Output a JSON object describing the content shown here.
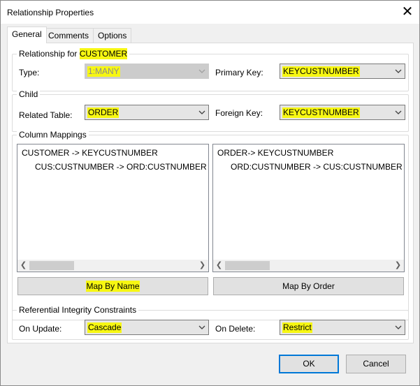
{
  "window": {
    "title": "Relationship Properties",
    "close_glyph": "✕"
  },
  "tabs": [
    {
      "label": "General",
      "active": true
    },
    {
      "label": "Comments",
      "active": false
    },
    {
      "label": "Options",
      "active": false
    }
  ],
  "relationship": {
    "group_prefix": "Relationship for ",
    "group_table": "CUSTOMER",
    "type_label": "Type:",
    "type_value": "1:MANY",
    "primary_key_label": "Primary Key:",
    "primary_key_value": "KEYCUSTNUMBER"
  },
  "child": {
    "group_label": "Child",
    "related_table_label": "Related Table:",
    "related_table_value": "ORDER",
    "foreign_key_label": "Foreign Key:",
    "foreign_key_value": "KEYCUSTNUMBER"
  },
  "mappings": {
    "group_label": "Column Mappings",
    "left_list": [
      "CUSTOMER -> KEYCUSTNUMBER",
      "CUS:CUSTNUMBER -> ORD:CUSTNUMBER"
    ],
    "right_list": [
      "ORDER-> KEYCUSTNUMBER",
      "ORD:CUSTNUMBER -> CUS:CUSTNUMBER"
    ],
    "map_by_name": "Map By Name",
    "map_by_order": "Map By Order"
  },
  "integrity": {
    "group_label": "Referential Integrity Constraints",
    "on_update_label": "On Update:",
    "on_update_value": "Cascade",
    "on_delete_label": "On Delete:",
    "on_delete_value": "Restrict"
  },
  "footer": {
    "ok": "OK",
    "cancel": "Cancel"
  },
  "icons": {
    "dropdown": "chevron-down-icon",
    "scroll_left": "scroll-left-icon",
    "scroll_right": "scroll-right-icon",
    "close": "close-icon"
  },
  "colors": {
    "highlight": "#f6f600",
    "default_button_border": "#0078d7"
  }
}
